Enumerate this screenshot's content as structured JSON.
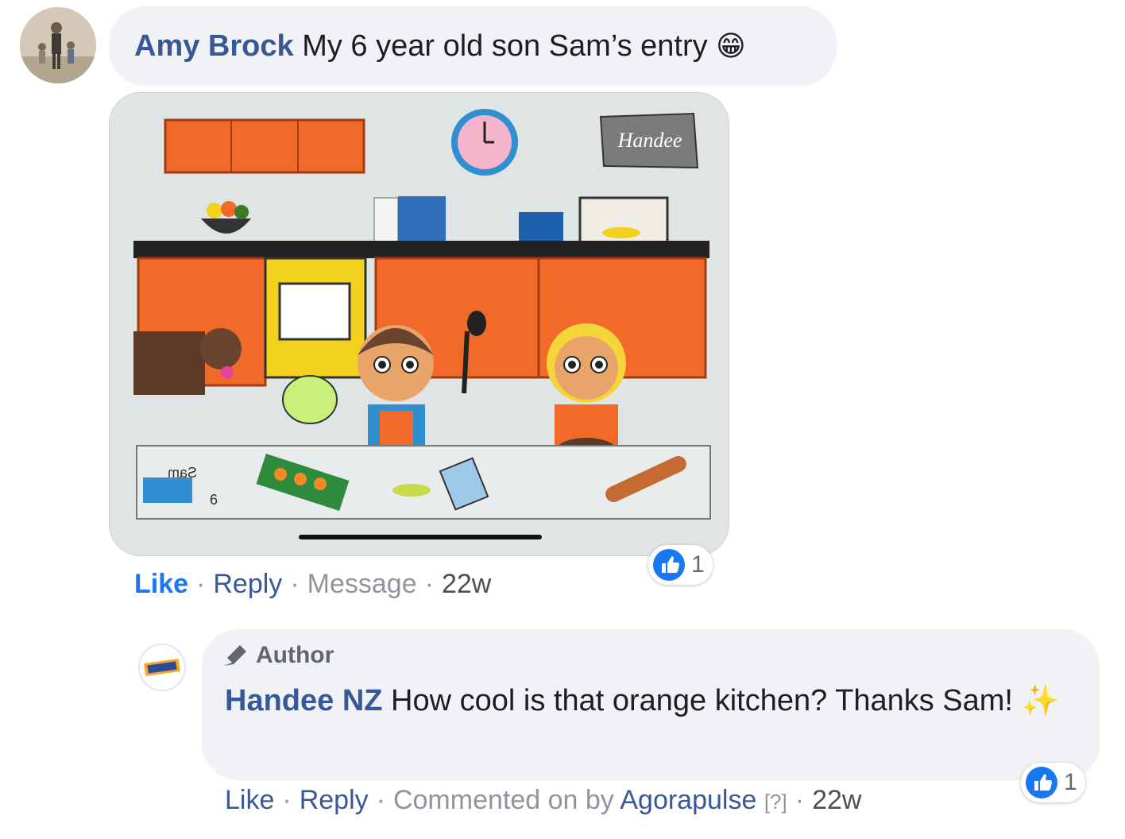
{
  "comment": {
    "author": "Amy Brock",
    "text": "My 6 year old son Sam’s entry",
    "emoji": "😁",
    "photo_alt": "Child's drawing of two kids baking in an orange kitchen",
    "photo_texts": {
      "brand": "Handee",
      "name": "Sam",
      "age": "6"
    },
    "actions": {
      "like": "Like",
      "reply": "Reply",
      "message": "Message",
      "time": "22w"
    },
    "reaction_count": "1"
  },
  "reply": {
    "badge": "Author",
    "author": "Handee NZ",
    "text": "How cool is that orange kitchen? Thanks Sam!",
    "emoji": "✨",
    "actions": {
      "like": "Like",
      "reply": "Reply",
      "commented_on_by": "Commented on by",
      "tool": "Agorapulse",
      "help": "[?]",
      "time": "22w"
    },
    "reaction_count": "1"
  },
  "icons": {
    "avatar_amy": "person-avatar-icon",
    "avatar_handee": "brand-logo-icon",
    "author_badge": "pencil-icon",
    "reaction": "thumbs-up-icon"
  },
  "colors": {
    "link": "#385898",
    "liked": "#1877f2",
    "meta": "#90949c",
    "bubble": "#f0f2f5",
    "like_reaction": "#1877f2"
  }
}
